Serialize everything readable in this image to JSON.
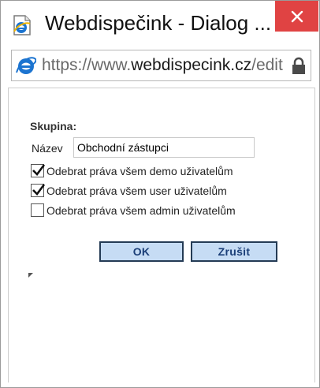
{
  "window": {
    "title": "Webdispečink - Dialog ...",
    "close_icon": "close-icon",
    "app_icon": "ie-page-icon"
  },
  "address_bar": {
    "url_prefix": "https://www.",
    "url_domain": "webdispecink.cz",
    "url_suffix": "/edita",
    "browser_icon": "ie-logo-icon",
    "lock_icon": "lock-icon"
  },
  "form": {
    "section_title": "Skupina:",
    "name_label": "Název",
    "name_value": "Obchodní zástupci",
    "checkboxes": [
      {
        "label": "Odebrat práva všem demo uživatelům",
        "checked": true
      },
      {
        "label": "Odebrat práva všem user uživatelům",
        "checked": true
      },
      {
        "label": "Odebrat práva všem admin uživatelům",
        "checked": false
      }
    ],
    "ok_label": "OK",
    "cancel_label": "Zrušit"
  },
  "colors": {
    "close_button": "#e04343",
    "button_fill": "#c6dcf4",
    "button_text": "#1b3f78",
    "ie_blue": "#1c74d0"
  }
}
